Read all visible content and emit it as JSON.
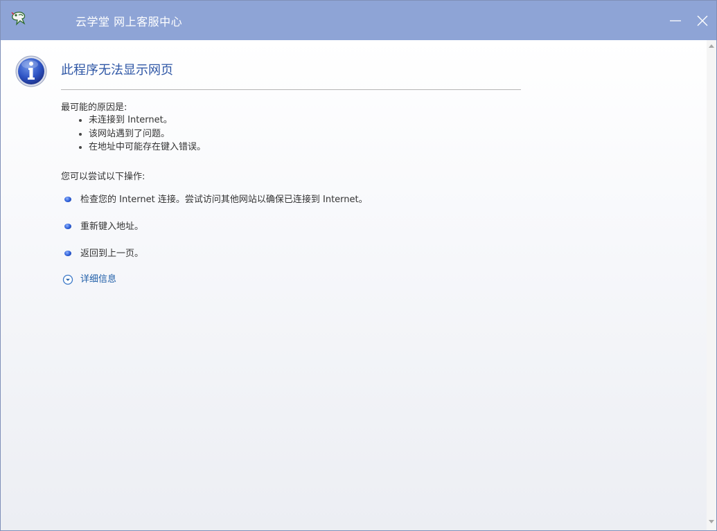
{
  "window": {
    "title": "云学堂  网上客服中心",
    "controls": {
      "minimize_icon": "minimize-icon",
      "close_icon": "close-icon"
    },
    "titlebar_color": "#8ea4d6"
  },
  "page": {
    "icon": "info-icon",
    "heading": "此程序无法显示网页",
    "reasons_title": "最可能的原因是:",
    "reasons": [
      "未连接到 Internet。",
      "该网站遇到了问题。",
      "在地址中可能存在键入错误。"
    ],
    "try_title": "您可以尝试以下操作:",
    "actions": [
      "检查您的 Internet 连接。尝试访问其他网站以确保已连接到 Internet。",
      "重新键入地址。",
      "返回到上一页。"
    ],
    "details_label": "详细信息",
    "heading_color": "#2e56a5",
    "link_color": "#1f5ea8"
  }
}
